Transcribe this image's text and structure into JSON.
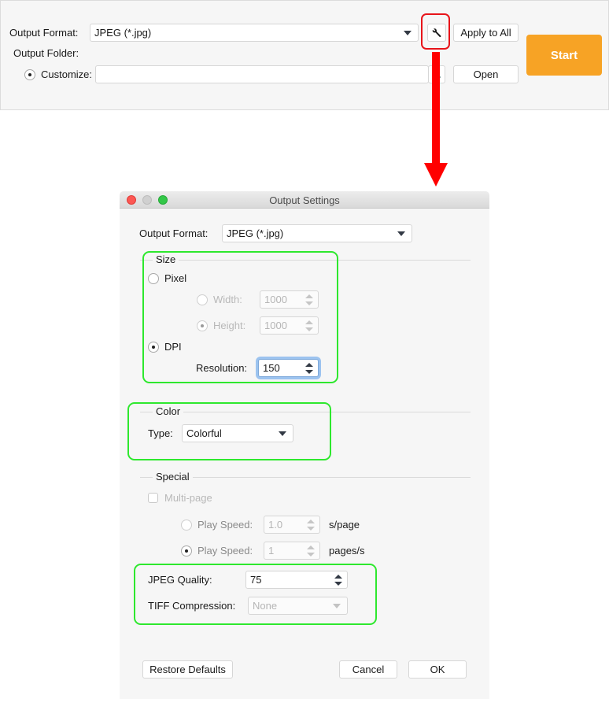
{
  "top_panel": {
    "output_format_label": "Output Format:",
    "output_format_value": "JPEG (*.jpg)",
    "settings_icon": "wrench-icon",
    "apply_to_all_label": "Apply to All",
    "output_folder_label": "Output Folder:",
    "customize_label": "Customize:",
    "customize_value": "",
    "browse_label": "...",
    "open_label": "Open",
    "start_label": "Start",
    "start_color": "#f7a325"
  },
  "annotation": {
    "highlight_color": "#e8141a",
    "arrow_color": "#ff0000",
    "group_highlight_color": "#2ee82e"
  },
  "dialog": {
    "title": "Output Settings",
    "output_format_label": "Output Format:",
    "output_format_value": "JPEG (*.jpg)",
    "size": {
      "title": "Size",
      "pixel_label": "Pixel",
      "pixel_selected": false,
      "width_label": "Width:",
      "width_value": "1000",
      "height_label": "Height:",
      "height_value": "1000",
      "dpi_label": "DPI",
      "dpi_selected": true,
      "resolution_label": "Resolution:",
      "resolution_value": "150"
    },
    "color": {
      "title": "Color",
      "type_label": "Type:",
      "type_value": "Colorful"
    },
    "special": {
      "title": "Special",
      "multipage_label": "Multi-page",
      "multipage_checked": false,
      "play_speed1_label": "Play Speed:",
      "play_speed1_value": "1.0",
      "play_speed1_unit": "s/page",
      "play_speed2_label": "Play Speed:",
      "play_speed2_value": "1",
      "play_speed2_unit": "pages/s"
    },
    "jpeg_quality_label": "JPEG Quality:",
    "jpeg_quality_value": "75",
    "tiff_compression_label": "TIFF Compression:",
    "tiff_compression_value": "None",
    "restore_defaults_label": "Restore Defaults",
    "cancel_label": "Cancel",
    "ok_label": "OK"
  }
}
